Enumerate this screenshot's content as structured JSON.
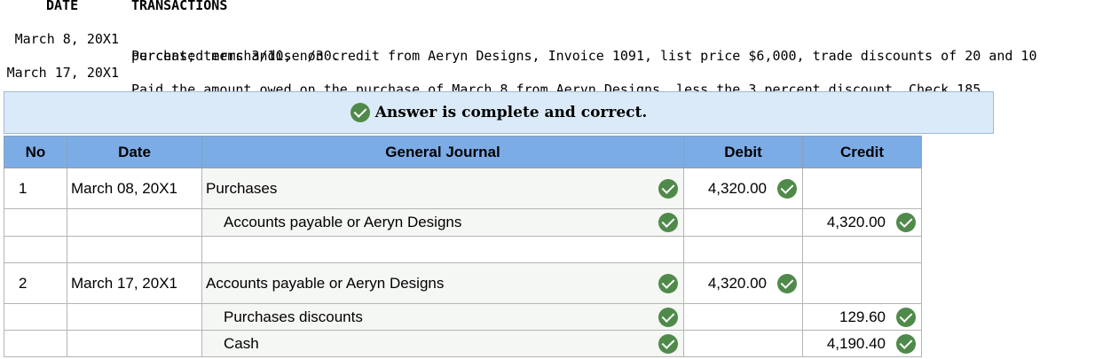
{
  "transactions": {
    "date_header": "DATE",
    "tx_header": "TRANSACTIONS",
    "rows": [
      {
        "date": "March 8, 20X1",
        "line1": "Purchased merchandise on credit from Aeryn Designs, Invoice 1091, list price $6,000, trade discounts of 20 and 10",
        "line2": "percent; terms 3/10, n/30."
      },
      {
        "date": "March 17, 20X1",
        "line1": "Paid the amount owed on the purchase of March 8 from Aeryn Designs, less the 3 percent discount, Check 185.",
        "line2": ""
      }
    ]
  },
  "banner": {
    "message": "Answer is complete and correct.",
    "icon": "check-circle-icon",
    "background": "#dbeaf8"
  },
  "journal": {
    "columns": {
      "no": "No",
      "date": "Date",
      "general_journal": "General Journal",
      "debit": "Debit",
      "credit": "Credit"
    },
    "header_color": "#7cace6",
    "check_color": "#4f8a4a",
    "rows": [
      {
        "no": "1",
        "date": "March 08, 20X1",
        "account": "Purchases",
        "debit": "4,320.00",
        "credit": ""
      },
      {
        "no": "",
        "date": "",
        "account": "Accounts payable or Aeryn Designs",
        "debit": "",
        "credit": "4,320.00"
      },
      {
        "no": "",
        "date": "",
        "account": "",
        "debit": "",
        "credit": ""
      },
      {
        "no": "2",
        "date": "March 17, 20X1",
        "account": "Accounts payable or Aeryn Designs",
        "debit": "4,320.00",
        "credit": ""
      },
      {
        "no": "",
        "date": "",
        "account": "Purchases discounts",
        "debit": "",
        "credit": "129.60"
      },
      {
        "no": "",
        "date": "",
        "account": "Cash",
        "debit": "",
        "credit": "4,190.40"
      }
    ]
  }
}
